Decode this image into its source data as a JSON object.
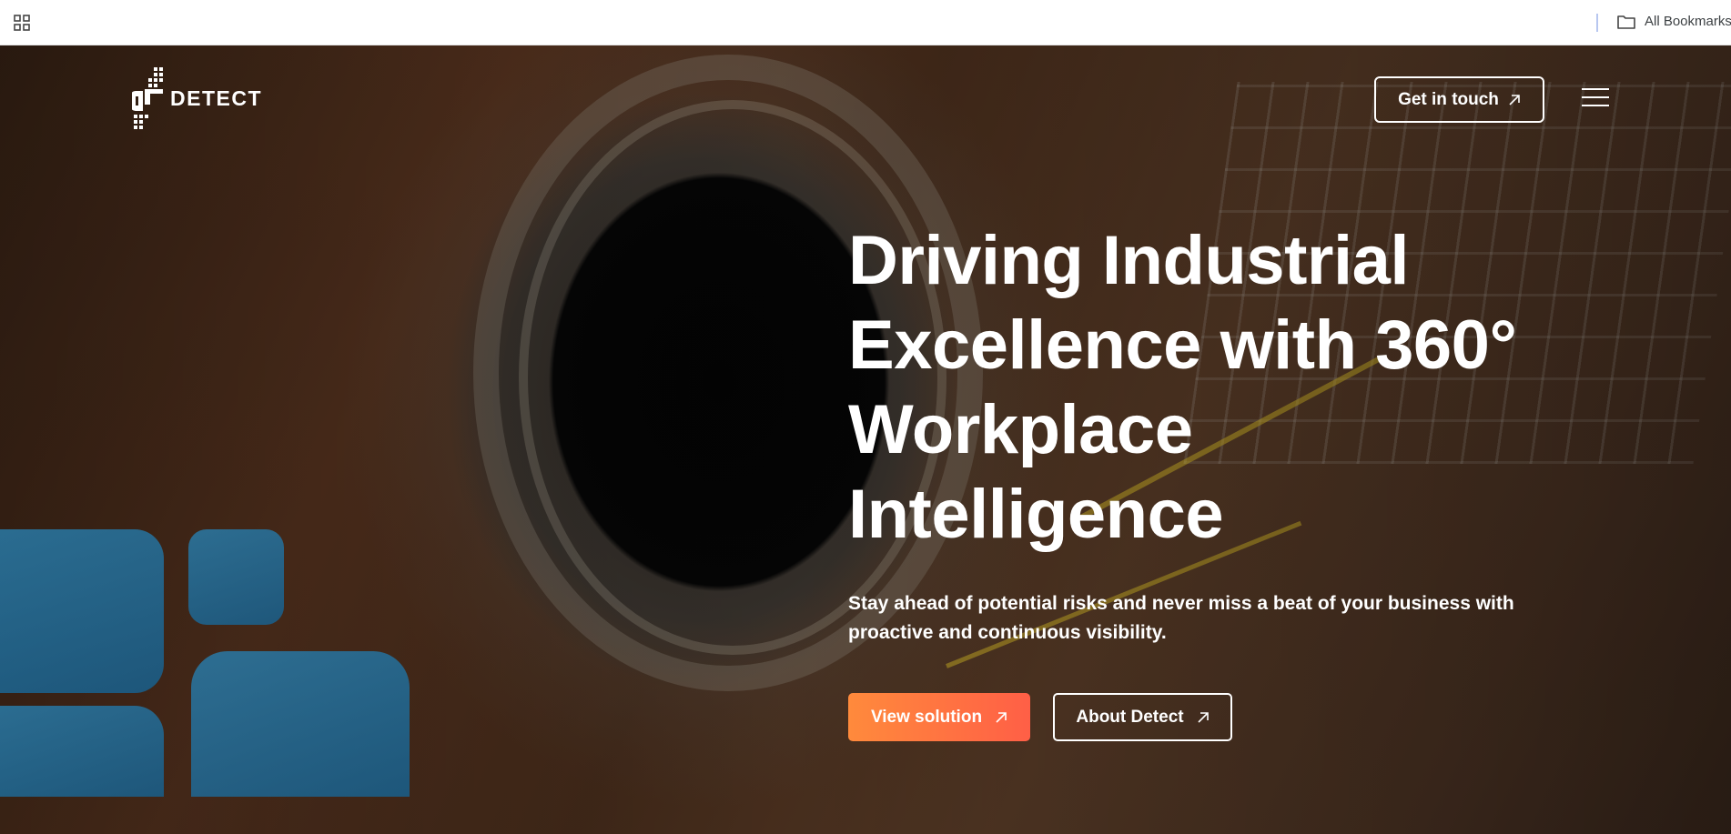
{
  "browser": {
    "bookmarks_label": "All Bookmarks",
    "apps_icon": "apps-grid-icon",
    "folder_icon": "folder-icon"
  },
  "header": {
    "logo_text": "DETECT",
    "cta_label": "Get in touch",
    "menu_icon": "hamburger-menu-icon"
  },
  "hero": {
    "title_lines": [
      "Driving Industrial",
      "Excellence with 360°",
      "Workplace",
      "Intelligence"
    ],
    "subtitle_lines": [
      "Stay ahead of potential risks and never miss a beat of your business with",
      "proactive and continuous visibility."
    ],
    "primary_button": "View solution",
    "secondary_button": "About Detect"
  },
  "colors": {
    "accent_start": "#ff8a3c",
    "accent_end": "#ff5f46",
    "deco_blue": "#2882b4",
    "text": "#ffffff"
  }
}
